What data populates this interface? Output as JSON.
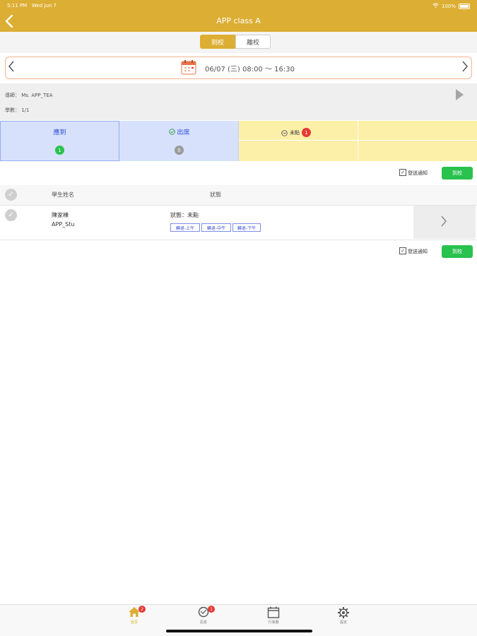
{
  "status": {
    "time": "5:11 PM",
    "date": "Wed Jun 7",
    "battery": "100%"
  },
  "nav": {
    "title": "APP class A"
  },
  "segments": [
    {
      "label": "到校"
    },
    {
      "label": "離校"
    }
  ],
  "datebar": {
    "text": "06/07 (三) 08:00 ～ 16:30"
  },
  "info": {
    "teacher": "導師：  Ms. APP_TEA",
    "count": "學數：  1/1"
  },
  "tiles": {
    "present": {
      "label": "應到",
      "count": "1"
    },
    "attend": {
      "label": "出席",
      "count": "0"
    },
    "absent": {
      "label": "未點",
      "count": "1"
    }
  },
  "controls": {
    "notify_label": "發送通知",
    "button_label": "到校"
  },
  "table": {
    "headers": {
      "name": "學生姓名",
      "status": "狀態"
    },
    "rows": [
      {
        "name": "陳家棟",
        "id": "APP_Stu",
        "status": "狀態：未點",
        "tags": [
          "轉退-上午",
          "轉退-中午",
          "轉退-下午"
        ]
      }
    ]
  },
  "tabs": [
    {
      "label": "首頁",
      "icon": "home-icon",
      "badge": "2"
    },
    {
      "label": "訊息",
      "icon": "message-icon",
      "badge": "1"
    },
    {
      "label": "行事曆",
      "icon": "calendar-icon",
      "badge": ""
    },
    {
      "label": "設定",
      "icon": "gear-icon",
      "badge": ""
    }
  ],
  "colors": {
    "accent": "#dcae33",
    "green": "#29c24e",
    "blue_tile": "#d7e1fb",
    "yellow_tile": "#fcf0a9",
    "badge_red": "#e53935"
  }
}
